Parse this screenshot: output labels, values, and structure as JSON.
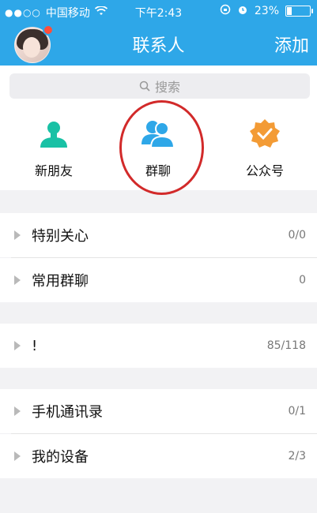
{
  "status_bar": {
    "signal": "●●○○",
    "carrier": "中国移动",
    "time": "下午2:43",
    "battery": "23%",
    "battery_level": 0.23
  },
  "nav": {
    "title": "联系人",
    "add_label": "添加"
  },
  "search": {
    "placeholder": "搜索"
  },
  "quick_actions": [
    {
      "label": "新朋友"
    },
    {
      "label": "群聊"
    },
    {
      "label": "公众号"
    }
  ],
  "groups": [
    {
      "name": "特别关心",
      "count": "0/0"
    },
    {
      "name": "常用群聊",
      "count": "0"
    },
    {
      "name": "!",
      "count": "85/118"
    },
    {
      "name": "手机通讯录",
      "count": "0/1"
    },
    {
      "name": "我的设备",
      "count": "2/3"
    }
  ],
  "colors": {
    "brand": "#2ea7e8",
    "new_friend_icon": "#19c1a5",
    "group_icon": "#2ea7e8",
    "official_icon": "#f39b35",
    "annotation_circle": "#d22a2a"
  }
}
